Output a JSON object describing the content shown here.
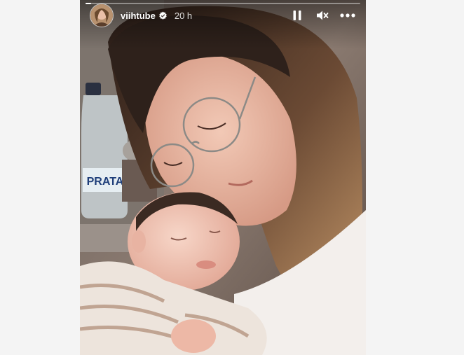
{
  "story": {
    "username": "viihtube",
    "verified": true,
    "time_ago": "20 h",
    "progress": 0.02,
    "controls": {
      "pause_icon": "pause-icon",
      "mute_icon": "muted-speaker-icon",
      "more_icon": "more-horizontal-icon"
    }
  },
  "colors": {
    "page_background": "#f4f4f4",
    "verified_badge": "#ffffff"
  }
}
